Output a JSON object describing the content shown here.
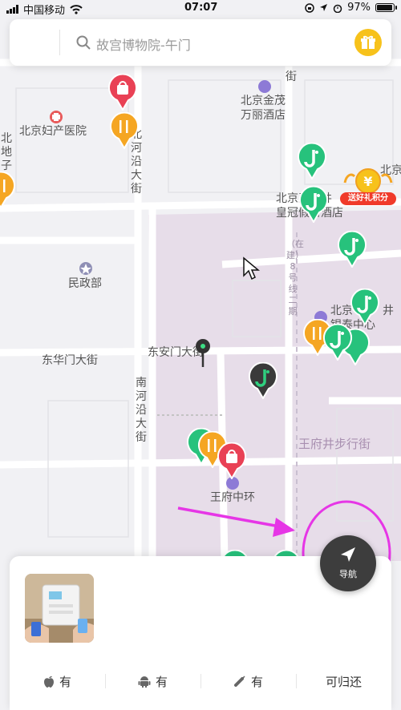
{
  "status_bar": {
    "carrier": "中国移动",
    "time": "07:07",
    "battery": "97%",
    "battery_level": 0.97
  },
  "search": {
    "placeholder": "故宫博物院-午门"
  },
  "map": {
    "labels": {
      "beijing_maternity_hospital": "北京妇产医院",
      "jinmao_hotel": "北京金茂\n万丽酒店",
      "ministry_civil_affairs": "民政部",
      "donghuamen_st": "东华门大街",
      "donganmen_st": "东安门大街",
      "wangfujing_walk": "王府井步行街",
      "wangfu_central": "王府中环",
      "crowne_plaza": "北京王府井\n皇冠假日酒店",
      "beijing_right": "北京",
      "beijing_right2": "北京",
      "bj_jing": "北京\n银泰中心",
      "wangfujing_jing": "井",
      "station_8": "8",
      "north_heyan": "北河沿大街",
      "south_heyan": "南河沿大街",
      "left_edge": "北地子",
      "line8": "（在建）8号线二期",
      "top_edge": "街"
    }
  },
  "promo": {
    "text": "送好礼积分"
  },
  "nav_button": {
    "label": "导航"
  },
  "features": [
    {
      "icon": "apple-icon",
      "label": "有"
    },
    {
      "icon": "android-icon",
      "label": "有"
    },
    {
      "icon": "cable-icon",
      "label": "有"
    },
    {
      "icon": "none",
      "label": "可归还"
    }
  ]
}
